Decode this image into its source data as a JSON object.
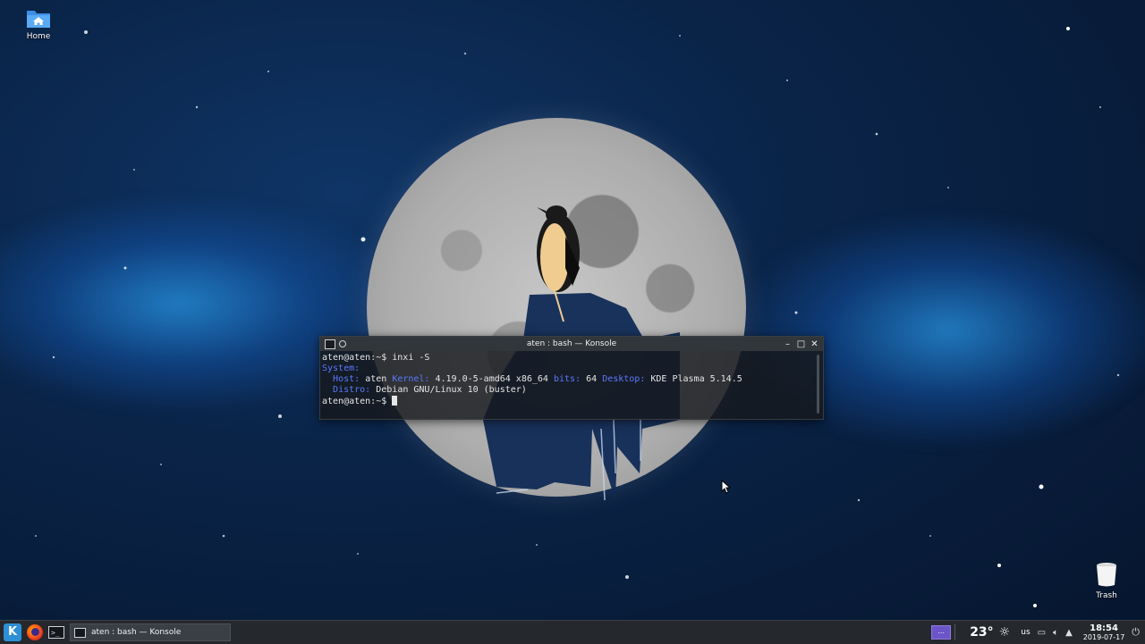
{
  "desktop": {
    "home_label": "Home",
    "trash_label": "Trash"
  },
  "konsole": {
    "title": "aten : bash — Konsole",
    "lines": {
      "prompt1": "aten@aten:~$ inxi -S",
      "system_label": "System:",
      "host_key": "Host:",
      "host_val": "aten",
      "kernel_key": "Kernel:",
      "kernel_val": "4.19.0-5-amd64 x86_64",
      "bits_key": "bits:",
      "bits_val": "64",
      "desktop_key": "Desktop:",
      "desktop_val": "KDE Plasma 5.14.5",
      "distro_key": "Distro:",
      "distro_val": "Debian GNU/Linux 10 (buster)",
      "prompt2": "aten@aten:~$"
    },
    "colors": {
      "accent": "#5a78ff",
      "text": "#e6e6e6"
    }
  },
  "taskbar": {
    "task_label": "aten : bash — Konsole",
    "pager_label": "...",
    "temperature": "23°",
    "keyboard_layout": "us",
    "time": "18:54",
    "date": "2019-07-17",
    "icons": [
      "kde-launcher-icon",
      "firefox-icon",
      "konsole-icon",
      "weather-sun-icon",
      "network-icon",
      "volume-icon",
      "tray-expand-icon",
      "power-icon"
    ]
  }
}
